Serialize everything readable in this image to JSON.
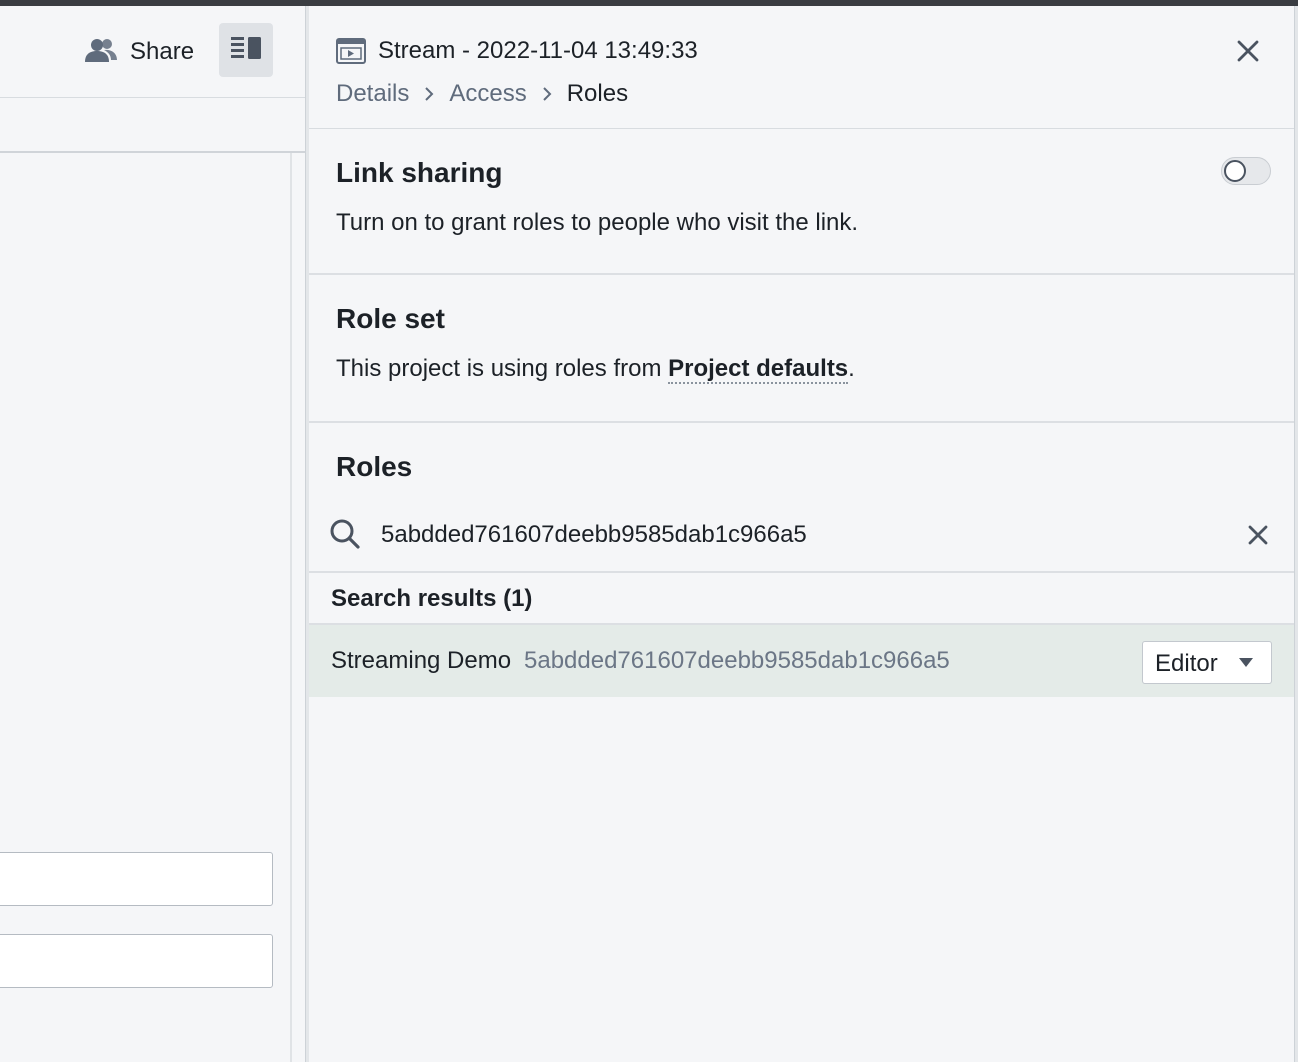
{
  "left_pane": {
    "share_label": "Share"
  },
  "panel": {
    "title": "Stream - 2022-11-04 13:49:33",
    "breadcrumb": {
      "details": "Details",
      "access": "Access",
      "current": "Roles"
    },
    "link_sharing": {
      "title": "Link sharing",
      "description": "Turn on to grant roles to people who visit the link.",
      "enabled": false
    },
    "role_set": {
      "title": "Role set",
      "prefix": "This project is using roles from ",
      "link": "Project defaults",
      "suffix": "."
    },
    "roles": {
      "title": "Roles",
      "search_value": "5abdded761607deebb9585dab1c966a5",
      "results_header": "Search results (1)",
      "results": [
        {
          "name": "Streaming Demo",
          "id": "5abdded761607deebb9585dab1c966a5",
          "role": "Editor"
        }
      ]
    }
  },
  "icons": {
    "share": "people-icon",
    "panel_toggle": "panel-layout-icon",
    "stream": "stream-icon",
    "close": "close-icon",
    "search": "search-icon"
  },
  "colors": {
    "background": "#f5f6f8",
    "selected_row": "#e4ebe8",
    "muted_text": "#5f6b7c"
  }
}
